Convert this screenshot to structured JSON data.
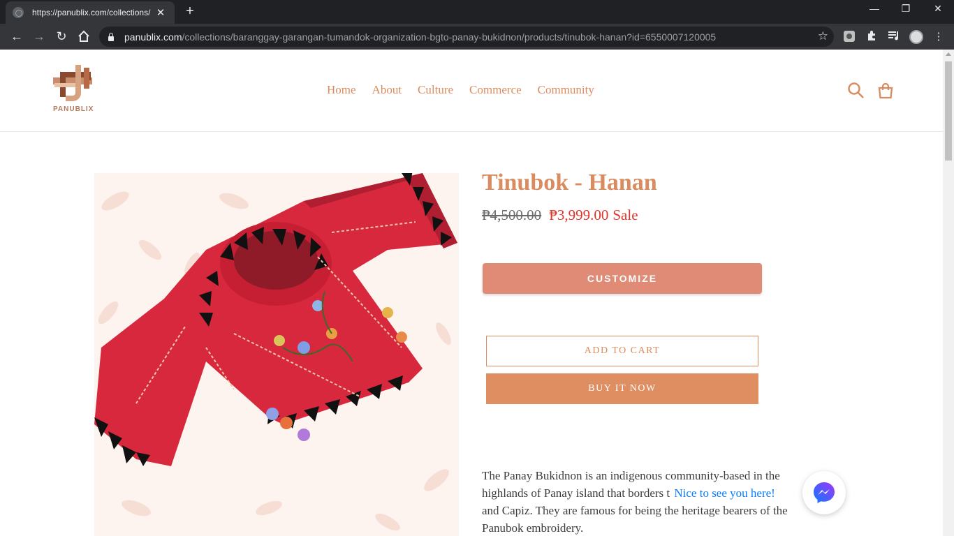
{
  "browser": {
    "tab_title": "https://panublix.com/collections/",
    "tab_close": "✕",
    "new_tab": "+",
    "url_host": "panublix.com",
    "url_path": "/collections/baranggay-garangan-tumandok-organization-bgto-panay-bukidnon/products/tinubok-hanan?id=6550007120005",
    "icons": [
      "back-icon",
      "forward-icon",
      "reload-icon",
      "home-icon",
      "lock-icon",
      "star-icon",
      "extension-icon",
      "puzzle-icon",
      "media-icon",
      "profile-avatar",
      "menu-icon"
    ]
  },
  "header": {
    "logo_text": "PANUBLIX",
    "nav": [
      "Home",
      "About",
      "Culture",
      "Commerce",
      "Community"
    ],
    "accent_color": "#d98c5f"
  },
  "product": {
    "title": "Tinubok - Hanan",
    "price_old": "₱4,500.00",
    "price_new": "₱3,999.00",
    "sale_label": "Sale",
    "customize_label": "CUSTOMIZE",
    "add_to_cart_label": "ADD TO CART",
    "buy_now_label": "BUY IT NOW",
    "description": {
      "line1": "The Panay Bukidnon is an indigenous community-based in the",
      "line2a": "highlands of Panay island that borders t",
      "line2b": "e",
      "line3": "and Capiz. They are famous for being the heritage bearers of the",
      "line4": "Panubok embroidery."
    }
  },
  "chat": {
    "greeting": "Nice to see you here!",
    "widget_icon": "messenger-icon"
  }
}
